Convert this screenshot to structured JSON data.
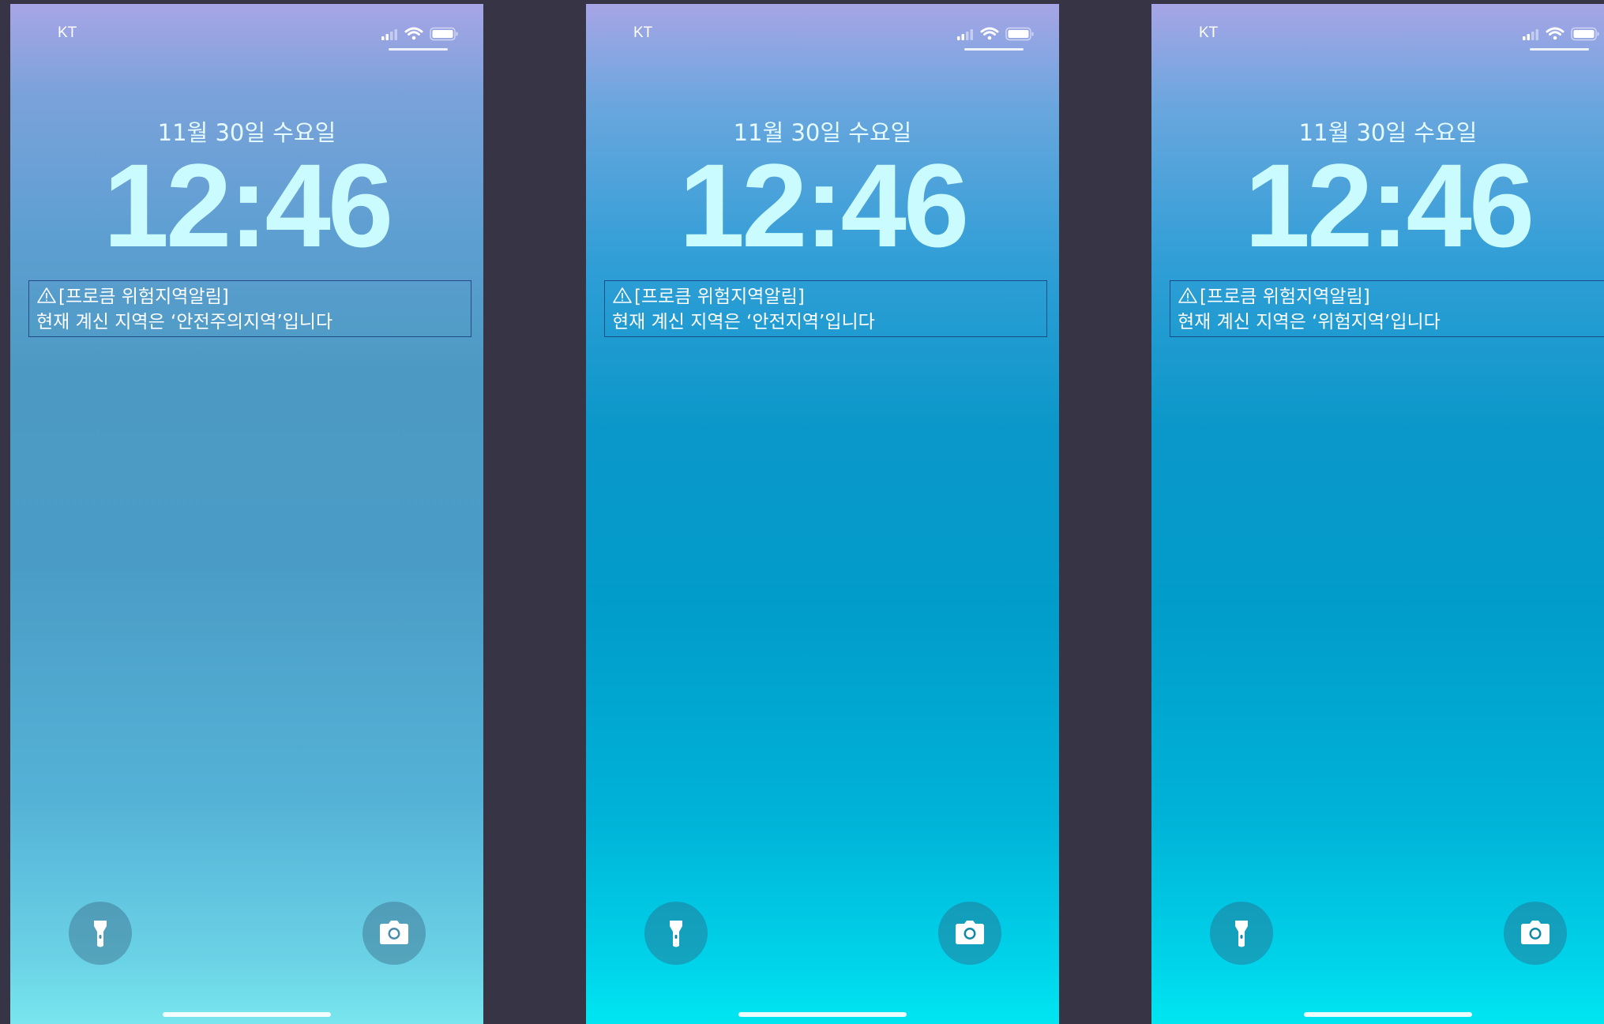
{
  "screens": [
    {
      "carrier": "KT",
      "date": "11월 30일 수요일",
      "time": "12:46",
      "notification": {
        "title": "[프로큼 위험지역알림]",
        "message": "현재 계신 지역은 ‘안전주의지역’입니다"
      },
      "icons": {
        "signal": "cellular-signal-icon",
        "wifi": "wifi-icon",
        "battery": "battery-icon",
        "warning": "warning-triangle-icon",
        "flashlight": "flashlight-icon",
        "camera": "camera-icon"
      }
    },
    {
      "carrier": "KT",
      "date": "11월 30일 수요일",
      "time": "12:46",
      "notification": {
        "title": "[프로큼 위험지역알림]",
        "message": "현재 계신 지역은 ‘안전지역’입니다"
      },
      "icons": {
        "signal": "cellular-signal-icon",
        "wifi": "wifi-icon",
        "battery": "battery-icon",
        "warning": "warning-triangle-icon",
        "flashlight": "flashlight-icon",
        "camera": "camera-icon"
      }
    },
    {
      "carrier": "KT",
      "date": "11월 30일 수요일",
      "time": "12:46",
      "notification": {
        "title": "[프로큼 위험지역알림]",
        "message": "현재 계신 지역은 ‘위험지역’입니다"
      },
      "icons": {
        "signal": "cellular-signal-icon",
        "wifi": "wifi-icon",
        "battery": "battery-icon",
        "warning": "warning-triangle-icon",
        "flashlight": "flashlight-icon",
        "camera": "camera-icon"
      }
    }
  ],
  "colors": {
    "background": "#363445",
    "clock": "#cafcff",
    "notification_border": "#14326e"
  }
}
